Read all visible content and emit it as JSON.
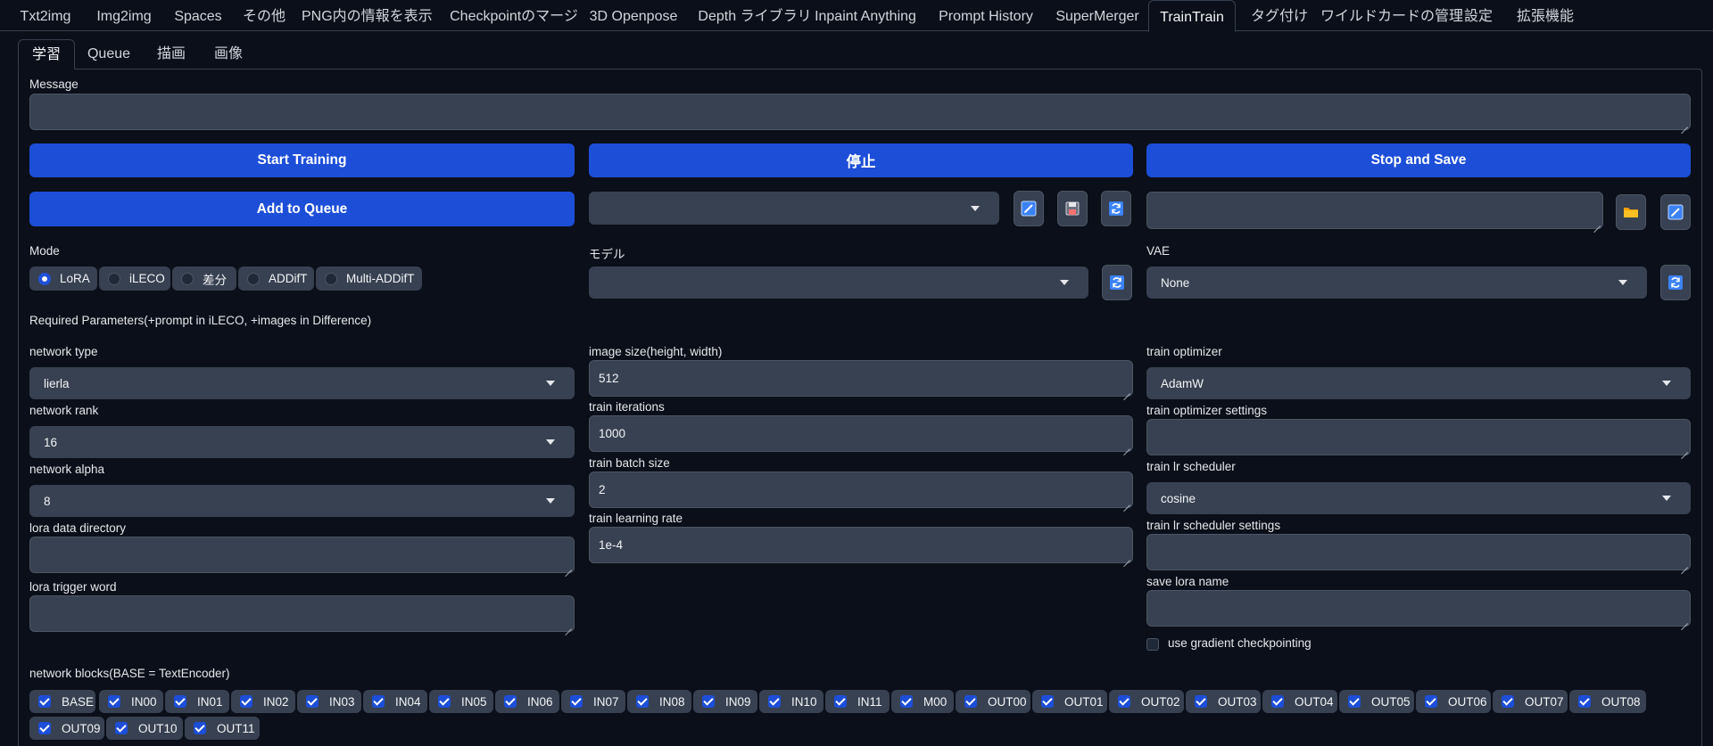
{
  "top_tabs": [
    "Txt2img",
    "Img2img",
    "Spaces",
    "その他",
    "PNG内の情報を表示",
    "Checkpointのマージ",
    "3D Openpose",
    "Depth ライブラリ",
    "Inpaint Anything",
    "Prompt History",
    "SuperMerger",
    "TrainTrain",
    "タグ付け",
    "ワイルドカードの管理",
    "設定",
    "拡張機能"
  ],
  "sub_tabs": [
    "学習",
    "Queue",
    "描画",
    "画像"
  ],
  "message": {
    "label": "Message",
    "value": ""
  },
  "buttons": {
    "start_training": "Start Training",
    "stop": "停止",
    "stop_and_save": "Stop and Save",
    "add_to_queue": "Add to Queue"
  },
  "preset": {
    "selected": "",
    "path": ""
  },
  "mode": {
    "label": "Mode",
    "options": [
      "LoRA",
      "iLECO",
      "差分",
      "ADDifT",
      "Multi-ADDifT"
    ],
    "selected": "LoRA"
  },
  "model": {
    "label": "モデル",
    "selected": ""
  },
  "vae": {
    "label": "VAE",
    "selected": "None"
  },
  "required_params_title": "Required Parameters(+prompt in iLECO, +images in Difference)",
  "left_fields": {
    "network_type": {
      "label": "network type",
      "value": "lierla"
    },
    "network_rank": {
      "label": "network rank",
      "value": "16"
    },
    "network_alpha": {
      "label": "network alpha",
      "value": "8"
    },
    "lora_data_directory": {
      "label": "lora data directory",
      "value": ""
    },
    "lora_trigger_word": {
      "label": "lora trigger word",
      "value": ""
    }
  },
  "mid_fields": {
    "image_size": {
      "label": "image size(height, width)",
      "value": "512"
    },
    "train_iterations": {
      "label": "train iterations",
      "value": "1000"
    },
    "train_batch_size": {
      "label": "train batch size",
      "value": "2"
    },
    "train_learning_rate": {
      "label": "train learning rate",
      "value": "1e-4"
    }
  },
  "right_fields": {
    "train_optimizer": {
      "label": "train optimizer",
      "value": "AdamW"
    },
    "train_optimizer_settings": {
      "label": "train optimizer settings",
      "value": ""
    },
    "train_lr_scheduler": {
      "label": "train lr scheduler",
      "value": "cosine"
    },
    "train_lr_scheduler_settings": {
      "label": "train lr scheduler settings",
      "value": ""
    },
    "save_lora_name": {
      "label": "save lora name",
      "value": ""
    },
    "use_gradient_checkpointing": {
      "label": "use gradient checkpointing",
      "checked": false
    }
  },
  "network_blocks": {
    "label": "network blocks(BASE = TextEncoder)",
    "items": [
      "BASE",
      "IN00",
      "IN01",
      "IN02",
      "IN03",
      "IN04",
      "IN05",
      "IN06",
      "IN07",
      "IN08",
      "IN09",
      "IN10",
      "IN11",
      "M00",
      "OUT00",
      "OUT01",
      "OUT02",
      "OUT03",
      "OUT04",
      "OUT05",
      "OUT06",
      "OUT07",
      "OUT08",
      "OUT09",
      "OUT10",
      "OUT11"
    ],
    "all_checked": true
  },
  "colors": {
    "accent": "#1d4ed8",
    "background": "#0b0f19",
    "input": "#374151"
  }
}
